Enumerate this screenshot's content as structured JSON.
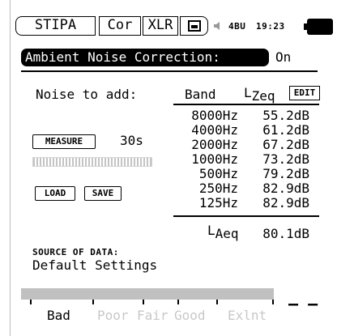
{
  "status_bar": {
    "mode": "STIPA",
    "correction": "Cor",
    "input": "XLR",
    "battery_voltage": "4BU",
    "time": "19:23"
  },
  "ambient": {
    "label": "Ambient Noise Correction:",
    "value": "On"
  },
  "noise": {
    "label": "Noise to add:",
    "measure_label": "MEASURE",
    "duration": "30s",
    "load_label": "LOAD",
    "save_label": "SAVE"
  },
  "table": {
    "band_header": "Band",
    "level_header_prefix": "L",
    "level_header_sub": "Zeq",
    "edit_label": "EDIT",
    "rows": [
      {
        "band": "8000Hz",
        "level": "55.2dB"
      },
      {
        "band": "4000Hz",
        "level": "61.2dB"
      },
      {
        "band": "2000Hz",
        "level": "67.2dB"
      },
      {
        "band": "1000Hz",
        "level": "73.2dB"
      },
      {
        "band": "500Hz",
        "level": "79.2dB"
      },
      {
        "band": "250Hz",
        "level": "82.9dB"
      },
      {
        "band": "125Hz",
        "level": "82.9dB"
      }
    ],
    "total_prefix": "L",
    "total_sub": "Aeq",
    "total_value": "80.1dB"
  },
  "source": {
    "label": "SOURCE OF DATA:",
    "value": "Default Settings"
  },
  "scale": {
    "labels": [
      "Bad",
      "Poor",
      "Fair",
      "Good",
      "Exlnt"
    ],
    "result": "– –",
    "colors": {
      "active": "#000000",
      "inactive": "#c8c8c8",
      "bar": "#c0c0c0"
    }
  }
}
